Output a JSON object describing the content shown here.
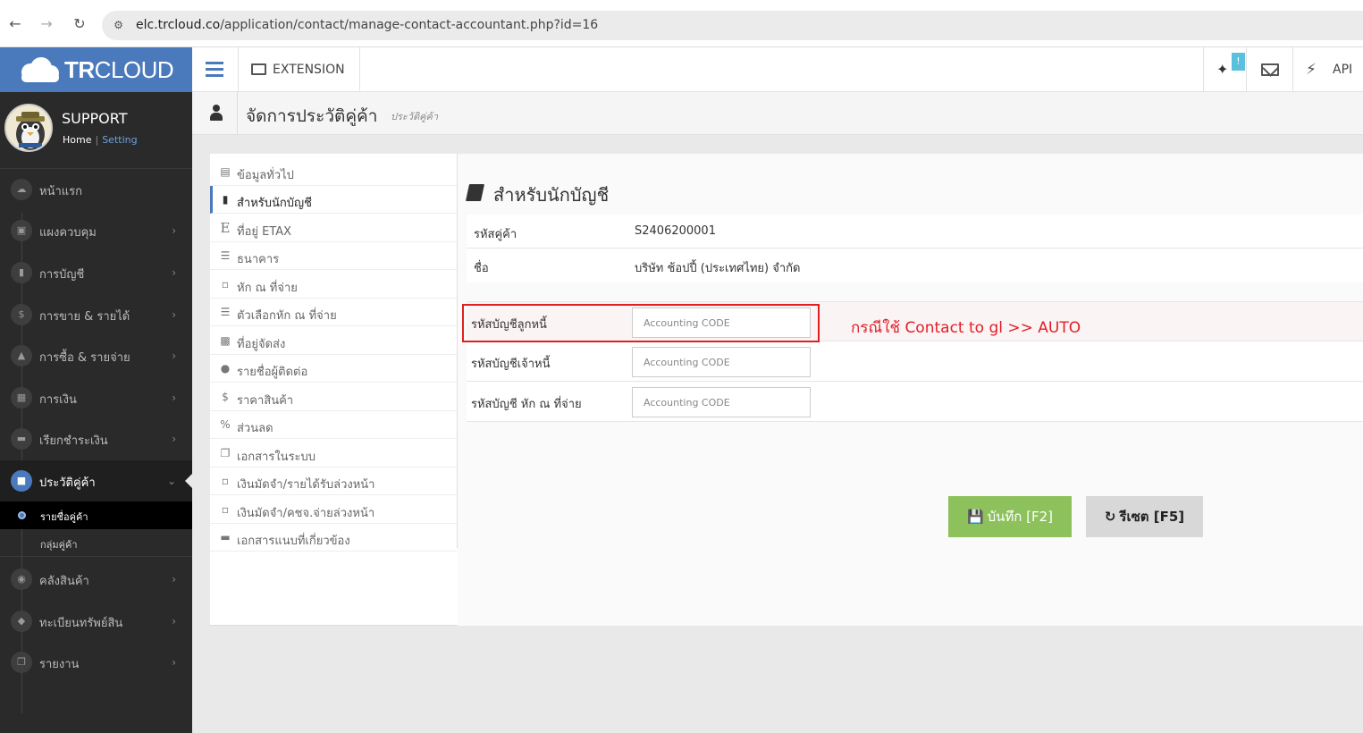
{
  "browser": {
    "url_host": "elc.trcloud.co",
    "url_path": "/application/contact/manage-contact-accountant.php?id=16"
  },
  "brand": {
    "logo_bold": "TR",
    "logo_rest": "CLOUD"
  },
  "user": {
    "name": "SUPPORT",
    "home": "Home",
    "separator": "|",
    "setting": "Setting"
  },
  "sidebar": {
    "items": [
      {
        "label": "หน้าแรก",
        "icon": "cloud-icon"
      },
      {
        "label": "แผงควบคุม",
        "icon": "monitor-icon"
      },
      {
        "label": "การบัญชี",
        "icon": "book-icon"
      },
      {
        "label": "การขาย & รายได้",
        "icon": "dollar-icon"
      },
      {
        "label": "การซื้อ & รายจ่าย",
        "icon": "cart-icon"
      },
      {
        "label": "การเงิน",
        "icon": "calendar-icon"
      },
      {
        "label": "เรียกชำระเงิน",
        "icon": "card-icon"
      },
      {
        "label": "ประวัติคู่ค้า",
        "icon": "contact-icon"
      },
      {
        "label": "คลังสินค้า",
        "icon": "cubes-icon"
      },
      {
        "label": "ทะเบียนทรัพย์สิน",
        "icon": "diamond-icon"
      },
      {
        "label": "รายงาน",
        "icon": "copy-icon"
      }
    ],
    "sub_items": [
      {
        "label": "รายชื่อคู่ค้า"
      },
      {
        "label": "กลุ่มคู่ค้า"
      }
    ]
  },
  "topbar": {
    "extension": "EXTENSION",
    "badge": "!",
    "api": "API"
  },
  "page": {
    "title": "จัดการประวัติคู่ค้า",
    "subtitle": "ประวัติคู่ค้า"
  },
  "tabs": [
    {
      "label": "ข้อมูลทั่วไป",
      "icon": "id-card-icon"
    },
    {
      "label": "สำหรับนักบัญชี",
      "icon": "book-icon"
    },
    {
      "label": "ที่อยู่ ETAX",
      "icon": "etax-e-icon"
    },
    {
      "label": "ธนาคาร",
      "icon": "bank-icon"
    },
    {
      "label": "หัก ณ ที่จ่าย",
      "icon": "file-word-icon"
    },
    {
      "label": "ตัวเลือกหัก ณ ที่จ่าย",
      "icon": "list-icon"
    },
    {
      "label": "ที่อยู่จัดส่ง",
      "icon": "truck-icon"
    },
    {
      "label": "รายชื่อผู้ติดต่อ",
      "icon": "users-icon"
    },
    {
      "label": "ราคาสินค้า",
      "icon": "dollar-icon"
    },
    {
      "label": "ส่วนลด",
      "icon": "percent-icon"
    },
    {
      "label": "เอกสารในระบบ",
      "icon": "copy-icon"
    },
    {
      "label": "เงินมัดจำ/รายได้รับล่วงหน้า",
      "icon": "file-icon"
    },
    {
      "label": "เงินมัดจำ/คชจ.จ่ายล่วงหน้า",
      "icon": "file-icon"
    },
    {
      "label": "เอกสารแนบที่เกี่ยวข้อง",
      "icon": "folder-icon"
    }
  ],
  "main": {
    "section_title": "สำหรับนักบัญชี",
    "info": [
      {
        "key": "รหัสคู่ค้า",
        "value": "S2406200001"
      },
      {
        "key": "ชื่อ",
        "value": "บริษัท ช้อปปี้ (ประเทศไทย) จำกัด"
      }
    ],
    "fields": [
      {
        "label": "รหัสบัญชีลูกหนี้",
        "value": "",
        "placeholder": "Accounting CODE"
      },
      {
        "label": "รหัสบัญชีเจ้าหนี้",
        "value": "",
        "placeholder": "Accounting CODE"
      },
      {
        "label": "รหัสบัญชี หัก ณ ที่จ่าย",
        "value": "",
        "placeholder": "Accounting CODE"
      }
    ],
    "annotation": "กรณีใช้ Contact to gl >>  AUTO",
    "save_label": "บันทึก [F2]",
    "reset_label": "รีเซต [F5]"
  },
  "colors": {
    "brand": "#4a79bc",
    "save": "#8dc15b",
    "annotation": "#e0202a"
  }
}
